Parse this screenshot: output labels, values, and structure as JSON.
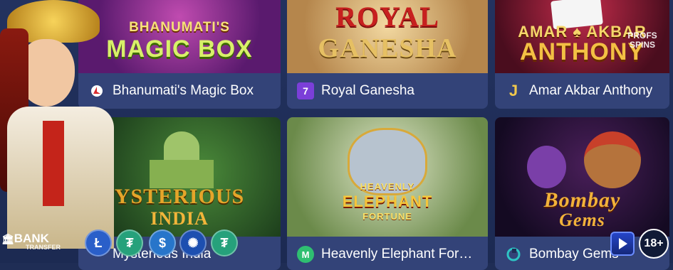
{
  "games": [
    {
      "name": "Bhanumati's Magic Box",
      "art_line1": "BHANUMATI'S",
      "art_line2": "MAGIC BOX",
      "provider_icon": "red-wheel-icon"
    },
    {
      "name": "Royal Ganesha",
      "art_line1": "ROYAL",
      "art_line2": "GANESHA",
      "provider_icon": "m7-logo-icon"
    },
    {
      "name": "Amar Akbar Anthony",
      "art_line1": "AMAR",
      "art_line1b": "AKBAR",
      "art_line2": "ANTHONY",
      "provider_icon": "yellow-j-icon"
    },
    {
      "name": "Mysterious India",
      "art_line1": "YSTERIOUS",
      "art_line2": "INDIA",
      "provider_icon": "generic-provider-icon"
    },
    {
      "name": "Heavenly Elephant For…",
      "art_line1": "HEAVENLY",
      "art_line2": "ELEPHANT",
      "art_line3": "FORTUNE",
      "provider_icon": "microgaming-icon"
    },
    {
      "name": "Bombay Gems",
      "art_line1": "Bombay",
      "art_line2": "Gems",
      "provider_icon": "teal-provider-icon"
    }
  ],
  "watermark": "PROFS SPINS",
  "age_badge": "18+",
  "bank_label": "BANK",
  "bank_sublabel": "TRANSFER",
  "coins": [
    {
      "symbol": "Ł",
      "icon": "litecoin-icon",
      "color": "#2a5fc9"
    },
    {
      "symbol": "₮",
      "icon": "tether-tron-icon",
      "color": "#26a17b"
    },
    {
      "symbol": "$",
      "icon": "usdc-icon",
      "color": "#2775ca"
    },
    {
      "symbol": "✺",
      "icon": "cardano-icon",
      "color": "#1d4fb0"
    },
    {
      "symbol": "₮",
      "icon": "tether-bnb-icon",
      "color": "#26a17b"
    }
  ],
  "colors": {
    "bg": "#1f2d55",
    "caption": "#334378",
    "accent_gold": "#f2c94c"
  }
}
